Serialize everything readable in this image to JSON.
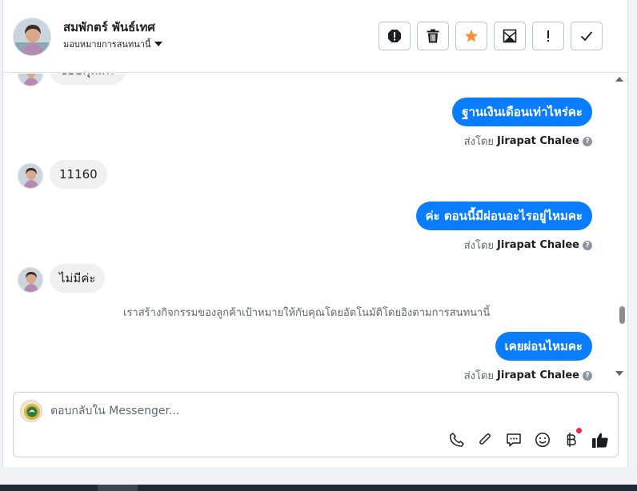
{
  "header": {
    "contact_name": "สมพักตร์ พันธ์เทศ",
    "assign_label": "มอบหมายการสนทนานี้",
    "actions": [
      {
        "name": "mark-spam-button",
        "icon": "alert-octagon-icon"
      },
      {
        "name": "delete-button",
        "icon": "trash-icon"
      },
      {
        "name": "star-button",
        "icon": "star-icon"
      },
      {
        "name": "mark-unread-button",
        "icon": "envelope-icon"
      },
      {
        "name": "follow-up-button",
        "icon": "exclamation-icon"
      },
      {
        "name": "mark-done-button",
        "icon": "checkmark-icon"
      }
    ]
  },
  "messages": {
    "m1_partial": "ขอบคุณค่ะ",
    "m2": "ฐานเงินเดือนเท่าไหร่คะ",
    "m3": "11160",
    "m4": "ค่ะ ตอนนี้มีผ่อนอะไรอยู่ไหมคะ",
    "m5": "ไม่มีค่ะ",
    "m6": "เคยผ่อนไหมคะ",
    "sent_by_prefix": "ส่งโดย",
    "sent_by_name": "Jirapat Chalee",
    "system_note": "เราสร้างกิจกรรมของลูกค้าเป้าหมายให้กับคุณโดยอัตโนมัติโดยอิงตามการสนทนานี้"
  },
  "composer": {
    "placeholder": "ตอบกลับใน Messenger...",
    "tools": [
      "phone-icon",
      "paperclip-icon",
      "chat-bubble-icon",
      "emoji-icon",
      "baht-icon",
      "thumbs-up-icon"
    ]
  },
  "colors": {
    "outgoing_bubble": "#0a7cff",
    "incoming_bubble": "#f0f0f0",
    "star": "#f7923b",
    "notification_dot": "#f02849"
  }
}
